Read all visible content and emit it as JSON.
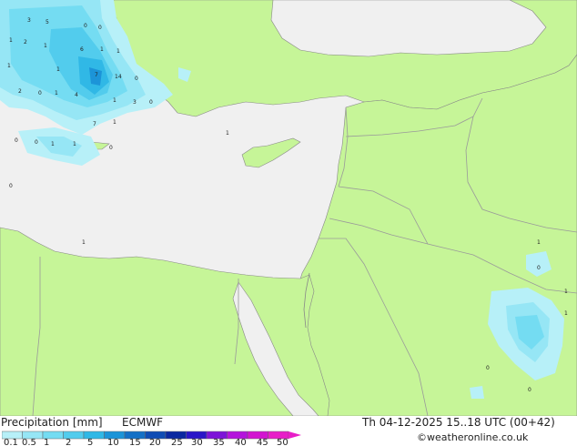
{
  "title": "Precipitation [mm]",
  "model": "ECMWF",
  "datetime": "Th 04-12-2025 15..18 UTC (00+42)",
  "credit": "©weatheronline.co.uk",
  "scale": {
    "labels": [
      "0.1",
      "0.5",
      "1",
      "2",
      "5",
      "10",
      "15",
      "20",
      "25",
      "30",
      "35",
      "40",
      "45",
      "50"
    ],
    "colors": [
      "#b7f0f8",
      "#96e6f5",
      "#74dcf2",
      "#52cced",
      "#30b8e6",
      "#1c94d8",
      "#1470c6",
      "#0f4cb4",
      "#0a28a0",
      "#2a16c8",
      "#7d14d8",
      "#b414dc",
      "#d214d0",
      "#e81ec8"
    ]
  },
  "colors": {
    "land": "#c6f598",
    "sea": "#f0f0f0",
    "border": "#9a9a9a",
    "coast": "#888888"
  },
  "map_values": [
    "3",
    "5",
    "1",
    "2",
    "0",
    "1",
    "6",
    "1",
    "0",
    "1",
    "7",
    "14",
    "0",
    "1",
    "2",
    "3",
    "1",
    "7",
    "4",
    "0",
    "1",
    "0",
    "1",
    "1",
    "0",
    "0",
    "1",
    "1",
    "0",
    "1",
    "0",
    "1",
    "1",
    "0",
    "1",
    "1",
    "0",
    "0"
  ]
}
